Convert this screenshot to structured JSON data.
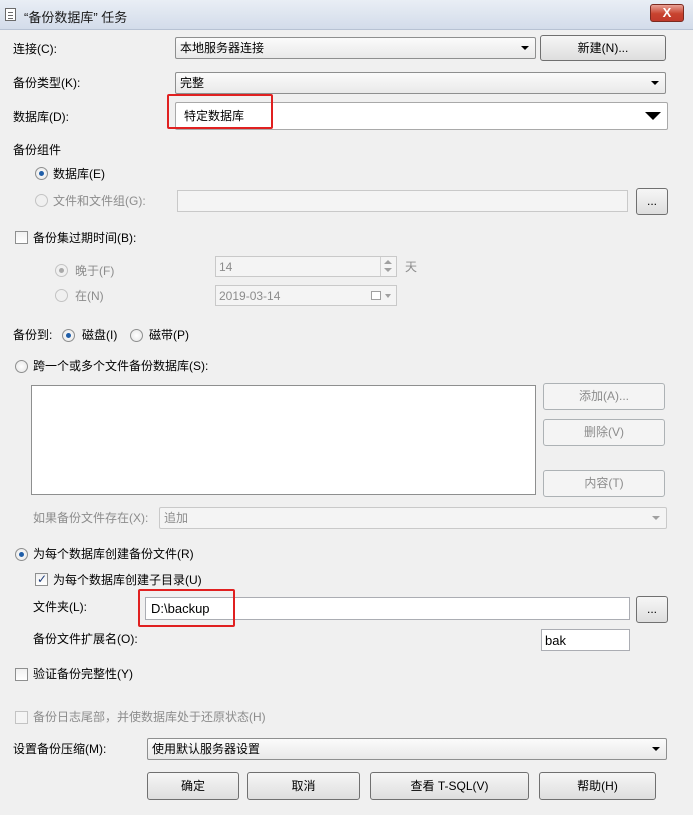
{
  "window": {
    "title": "“备份数据库” 任务",
    "close_label": "X"
  },
  "connection": {
    "label": "连接(C):",
    "value": "本地服务器连接",
    "new_button": "新建(N)..."
  },
  "backup_type": {
    "label": "备份类型(K):",
    "value": "完整"
  },
  "database": {
    "label": "数据库(D):",
    "value": "特定数据库"
  },
  "components": {
    "label": "备份组件",
    "database_radio": "数据库(E)",
    "files_radio": "文件和文件组(G):",
    "browse_label": "..."
  },
  "expiry": {
    "checkbox_label": "备份集过期时间(B):",
    "after_label": "晚于(F)",
    "after_value": "14",
    "days_unit": "天",
    "on_label": "在(N)",
    "on_value": "2019-03-14"
  },
  "backup_to": {
    "label": "备份到:",
    "disk": "磁盘(I)",
    "tape": "磁带(P)"
  },
  "span_files": {
    "radio_label": "跨一个或多个文件备份数据库(S):",
    "add_button": "添加(A)...",
    "remove_button": "删除(V)",
    "contents_button": "内容(T)",
    "if_exists_label": "如果备份文件存在(X):",
    "if_exists_value": "追加"
  },
  "per_db": {
    "radio_label": "为每个数据库创建备份文件(R)",
    "subdir_label": "为每个数据库创建子目录(U)",
    "folder_label": "文件夹(L):",
    "folder_value": "D:\\backup",
    "folder_browse": "...",
    "ext_label": "备份文件扩展名(O):",
    "ext_value": "bak"
  },
  "verify": {
    "label": "验证备份完整性(Y)"
  },
  "tail_log": {
    "label": "备份日志尾部，并使数据库处于还原状态(H)"
  },
  "compression": {
    "label": "设置备份压缩(M):",
    "value": "使用默认服务器设置"
  },
  "buttons": {
    "ok": "确定",
    "cancel": "取消",
    "tsql": "查看 T-SQL(V)",
    "help": "帮助(H)"
  },
  "colors": {
    "highlight": "#e02020",
    "radio_dot": "#1f5ea8",
    "close_red": "#c8432f"
  }
}
